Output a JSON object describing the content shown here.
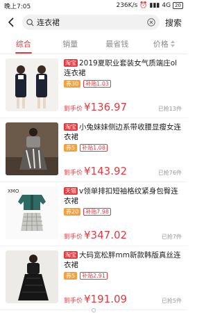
{
  "status": {
    "time": "晚上7:05",
    "network": "236K/s",
    "signal": "4G",
    "battery": "20"
  },
  "search": {
    "query": "连衣裙",
    "submit_label": "搜索"
  },
  "sort_tabs": [
    {
      "label": "综合",
      "active": true
    },
    {
      "label": "销量",
      "active": false
    },
    {
      "label": "最省钱",
      "active": false
    },
    {
      "label": "价格",
      "active": false
    }
  ],
  "products": [
    {
      "store": "淘宝",
      "title": "2019夏职业套装女气质端庄ol连衣裙",
      "coupon": "券30",
      "subsidy": "补贴1.03",
      "price_label": "到手价",
      "price": "¥136.97",
      "sold": "已抢13件"
    },
    {
      "store": "淘宝",
      "title": "小兔妹妹侧边系带收腰显瘦女连衣裙",
      "coupon": "券5",
      "subsidy": "补贴1.08",
      "price_label": "到手价",
      "price": "¥143.92",
      "sold": "已抢76件"
    },
    {
      "store": "天猫",
      "title": "v领单排扣短袖格纹紧身包臀连衣裙",
      "coupon": "券20",
      "subsidy": "补贴7.98",
      "price_label": "到手价",
      "price": "¥347.02",
      "sold": "已抢7件"
    },
    {
      "store": "淘宝",
      "title": "大码宽松胖mm新款韩版真丝连衣裙",
      "coupon": "券5",
      "subsidy": "补贴2.91",
      "price_label": "到手价",
      "price": "¥191.09",
      "sold": "已抢5件"
    }
  ],
  "thumb_logo": "XMO",
  "colors": {
    "accent": "#e8383d",
    "coupon": "#f5a03c"
  }
}
